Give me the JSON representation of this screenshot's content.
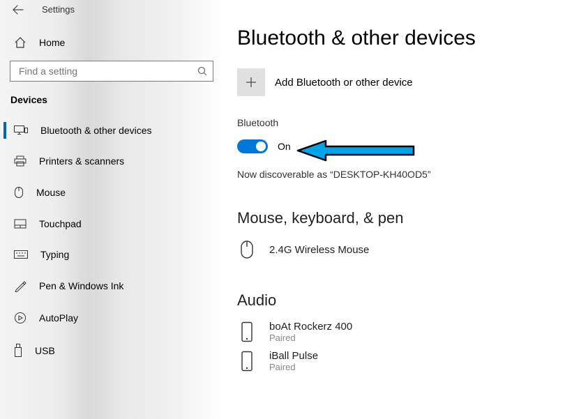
{
  "header": {
    "title": "Settings"
  },
  "search": {
    "placeholder": "Find a setting"
  },
  "sidebar": {
    "home": "Home",
    "section": "Devices",
    "items": [
      {
        "label": "Bluetooth & other devices"
      },
      {
        "label": "Printers & scanners"
      },
      {
        "label": "Mouse"
      },
      {
        "label": "Touchpad"
      },
      {
        "label": "Typing"
      },
      {
        "label": "Pen & Windows Ink"
      },
      {
        "label": "AutoPlay"
      },
      {
        "label": "USB"
      }
    ]
  },
  "main": {
    "title": "Bluetooth & other devices",
    "add_label": "Add Bluetooth or other device",
    "bluetooth_label": "Bluetooth",
    "toggle_state": "On",
    "discoverable": "Now discoverable as “DESKTOP-KH40OD5”",
    "section_mouse": "Mouse, keyboard, & pen",
    "mouse_device": "2.4G Wireless Mouse",
    "section_audio": "Audio",
    "audio_devices": [
      {
        "name": "boAt Rockerz 400",
        "status": "Paired"
      },
      {
        "name": "iBall Pulse",
        "status": "Paired"
      }
    ]
  }
}
